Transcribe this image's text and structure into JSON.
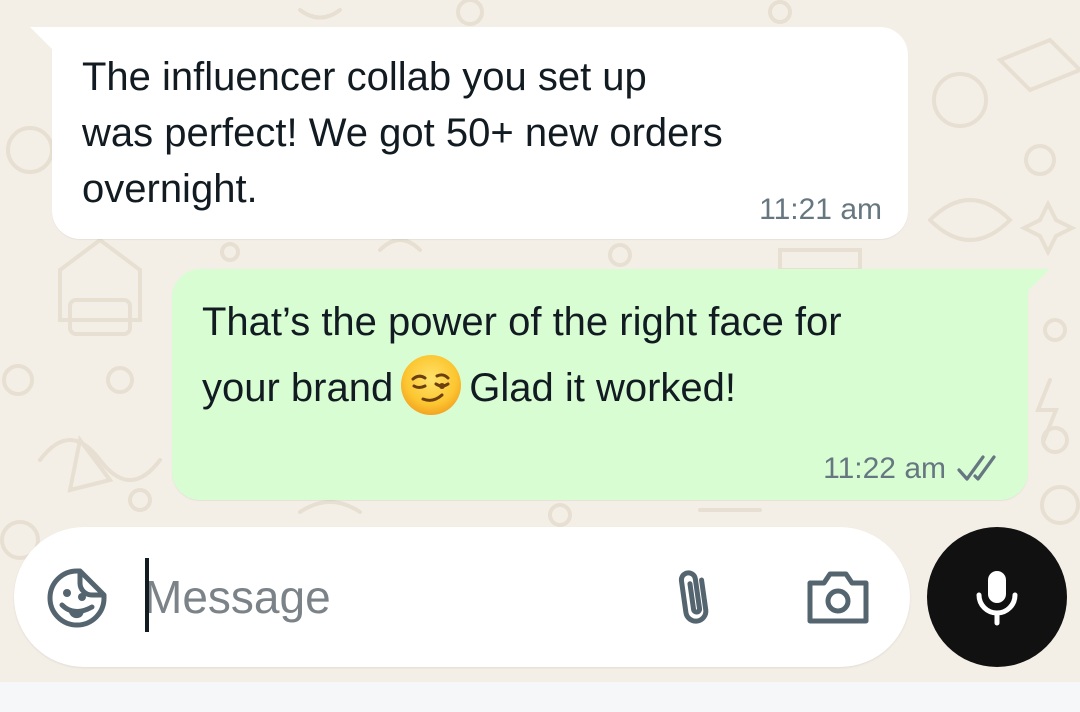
{
  "messages": [
    {
      "direction": "incoming",
      "text": "The influencer collab you set up\nwas perfect! We got 50+ new orders\novernight.",
      "time": "11:21 am"
    },
    {
      "direction": "outgoing",
      "text_before_emoji": "That’s the power of the right face for\nyour brand",
      "emoji": "smirking-face",
      "text_after_emoji": "Glad it worked!",
      "time": "11:22 am",
      "status": "delivered-double-tick"
    }
  ],
  "composer": {
    "placeholder": "Message",
    "value": ""
  },
  "icons": {
    "sticker": "sticker-face-icon",
    "attach": "paperclip-icon",
    "camera": "camera-icon",
    "mic": "microphone-icon"
  },
  "colors": {
    "incoming_bubble": "#ffffff",
    "outgoing_bubble": "#d9fdd3",
    "chat_background": "#f4efe6",
    "mic_button": "#111111",
    "timestamp": "#667781"
  }
}
